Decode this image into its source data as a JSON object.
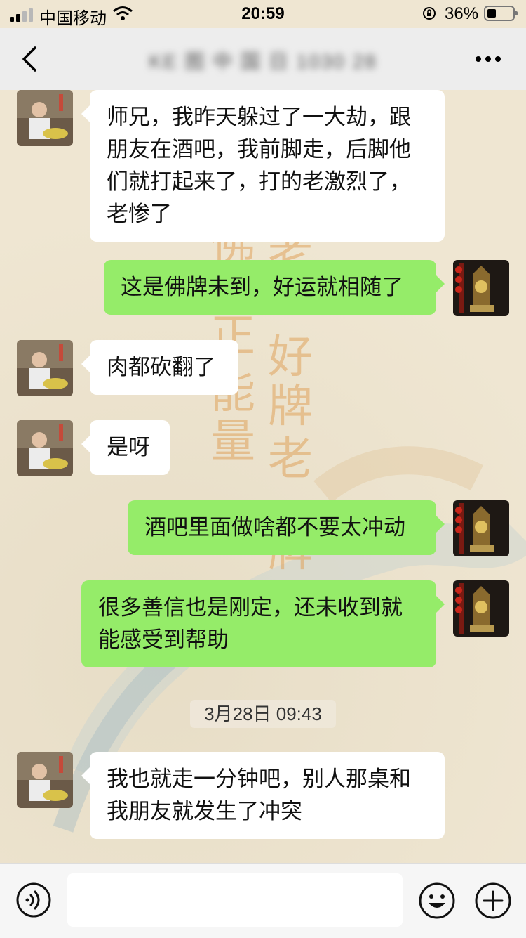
{
  "status_bar": {
    "carrier": "中国移动",
    "time": "20:59",
    "battery_percent": "36%",
    "battery_level": 0.36,
    "icons": [
      "signal-icon",
      "wifi-icon",
      "orientation-lock-icon",
      "battery-icon"
    ]
  },
  "nav": {
    "title": "KE 图 中 国 日 1030 28",
    "back_icon": "chevron-left-icon",
    "more_icon": "more-dots-icon"
  },
  "messages": [
    {
      "side": "in",
      "text": "师兄，我昨天躲过了一大劫，跟朋友在酒吧，我前脚走，后脚他们就打起来了，打的老激烈了，老惨了"
    },
    {
      "side": "out",
      "text": "这是佛牌未到，好运就相随了"
    },
    {
      "side": "in",
      "text": "肉都砍翻了"
    },
    {
      "side": "in",
      "text": "是呀"
    },
    {
      "side": "out",
      "text": "酒吧里面做啥都不要太冲动"
    },
    {
      "side": "out",
      "text": "很多善信也是刚定，还未收到就能感受到帮助"
    },
    {
      "side": "in",
      "text": "我也就走一分钟吧，别人那桌和我朋友就发生了冲突"
    }
  ],
  "timestamp": "3月28日 09:43",
  "background_text": [
    "佛",
    "正",
    "能",
    "量",
    "老",
    "好",
    "牌",
    "老",
    "牌"
  ],
  "input_bar": {
    "voice_icon": "voice-icon",
    "emoji_icon": "emoji-icon",
    "plus_icon": "plus-icon",
    "input_value": ""
  },
  "colors": {
    "outgoing_bubble": "#95ec69",
    "incoming_bubble": "#ffffff",
    "nav_background": "#ededed",
    "chat_background": "#efe6d2"
  }
}
